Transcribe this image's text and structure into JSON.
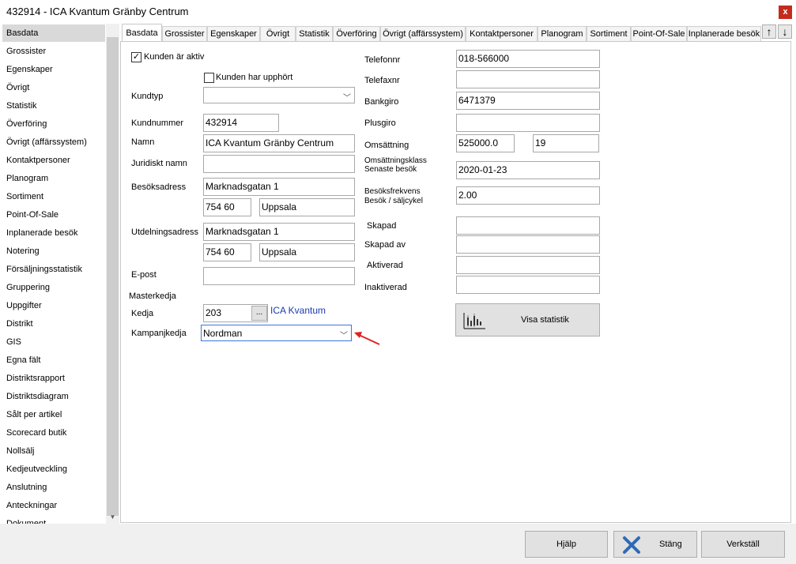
{
  "window": {
    "title": "432914 - ICA Kvantum Gränby Centrum",
    "close_label": "x"
  },
  "sidebar": {
    "items": [
      "Basdata",
      "Grossister",
      "Egenskaper",
      "Övrigt",
      "Statistik",
      "Överföring",
      "Övrigt (affärssystem)",
      "Kontaktpersoner",
      "Planogram",
      "Sortiment",
      "Point-Of-Sale",
      "Inplanerade besök",
      "Notering",
      "Försäljningsstatistik",
      "Gruppering",
      "Uppgifter",
      "Distrikt",
      "GIS",
      "Egna fält",
      "Distriktsrapport",
      "Distriktsdiagram",
      "Sålt per artikel",
      "Scorecard butik",
      "Nollsälj",
      "Kedjeutveckling",
      "Anslutning",
      "Anteckningar",
      "Dokument"
    ],
    "selected": "Basdata"
  },
  "tabs": [
    "Basdata",
    "Grossister",
    "Egenskaper",
    "Övrigt",
    "Statistik",
    "Överföring",
    "Övrigt (affärssystem)",
    "Kontaktpersoner",
    "Planogram",
    "Sortiment",
    "Point-Of-Sale",
    "Inplanerade besök"
  ],
  "form": {
    "kunden_aktiv": {
      "label": "Kunden är aktiv",
      "checked": true,
      "mark": "✓"
    },
    "kunden_upphort": {
      "label": "Kunden har upphört",
      "checked": false
    },
    "kundtyp": {
      "label": "Kundtyp",
      "value": ""
    },
    "kundnummer": {
      "label": "Kundnummer",
      "value": "432914"
    },
    "namn": {
      "label": "Namn",
      "value": "ICA Kvantum Gränby Centrum"
    },
    "juridiskt_namn": {
      "label": "Juridiskt namn",
      "value": ""
    },
    "besoksadress": {
      "label": "Besöksadress",
      "street": "Marknadsgatan 1",
      "zip": "754 60",
      "city": "Uppsala"
    },
    "utdelningsadress": {
      "label": "Utdelningsadress",
      "street": "Marknadsgatan 1",
      "zip": "754 60",
      "city": "Uppsala"
    },
    "epost": {
      "label": "E-post",
      "value": ""
    },
    "masterkedja": {
      "label": "Masterkedja"
    },
    "kedja": {
      "label": "Kedja",
      "value": "203",
      "button": "...",
      "link": "ICA Kvantum"
    },
    "kampanjkedja": {
      "label": "Kampanjkedja",
      "value": "Nordman"
    },
    "telefonnr": {
      "label": "Telefonnr",
      "value": "018-566000"
    },
    "telefaxnr": {
      "label": "Telefaxnr",
      "value": ""
    },
    "bankgiro": {
      "label": "Bankgiro",
      "value": "6471379"
    },
    "plusgiro": {
      "label": "Plusgiro",
      "value": ""
    },
    "omsattning": {
      "label": "Omsättning",
      "value": "525000.0",
      "klass": "19"
    },
    "omsattningsklass": {
      "label": "Omsättningsklass"
    },
    "senaste_besok": {
      "label": "Senaste besök",
      "value": "2020-01-23"
    },
    "besoksfrekvens": {
      "label1": "Besöksfrekvens",
      "label2": "Besök / säljcykel",
      "value": "2.00"
    },
    "skapad": {
      "label": "Skapad",
      "value": ""
    },
    "skapad_av": {
      "label": "Skapad av",
      "value": ""
    },
    "aktiverad": {
      "label": "Aktiverad",
      "value": ""
    },
    "inaktiverad": {
      "label": "Inaktiverad",
      "value": ""
    },
    "visa_statistik": "Visa statistik"
  },
  "buttons": {
    "hjalp": "Hjälp",
    "stang": "Stäng",
    "verkstall": "Verkställ"
  },
  "colors": {
    "accent": "#1a3bb0",
    "close": "#c42b1c",
    "annotation_arrow": "#e02020",
    "stang_icon": "#2f6ab5"
  }
}
